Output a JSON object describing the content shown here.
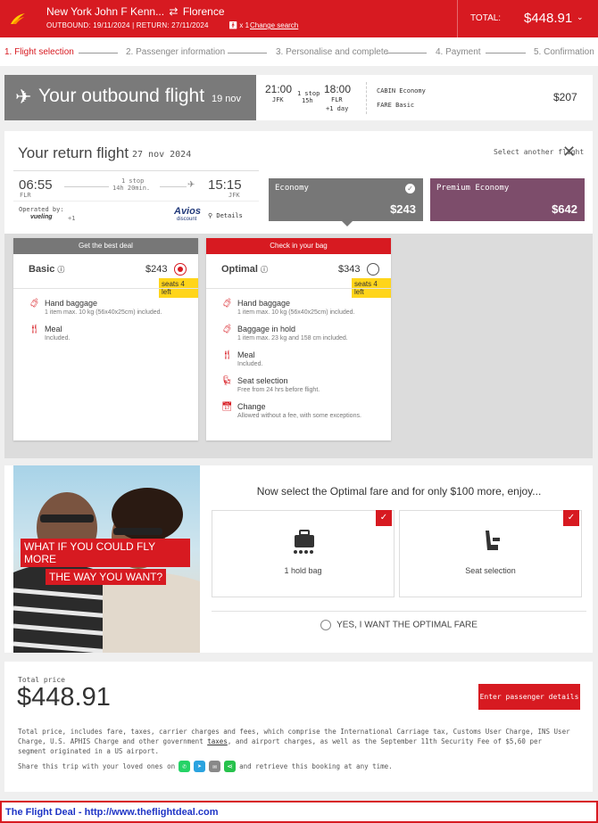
{
  "header": {
    "origin": "New York John F Kenn...",
    "swap_icon": "round-trip-arrows-icon",
    "destination": "Florence",
    "outbound_label": "OUTBOUND: 19/11/2024",
    "return_label": "RETURN: 27/11/2024",
    "passengers": "x 1",
    "change_search": "Change search",
    "total_label": "TOTAL:",
    "total_amount": "$448.91",
    "brand_color": "#d71a21"
  },
  "steps": [
    {
      "label": "1. Flight selection",
      "active": true
    },
    {
      "label": "2. Passenger information"
    },
    {
      "label": "3. Personalise and complete"
    },
    {
      "label": "4. Payment"
    },
    {
      "label": "5. Confirmation"
    }
  ],
  "outbound": {
    "title": "Your outbound flight",
    "date": "19 nov",
    "dep_time": "21:00",
    "dep_code": "JFK",
    "stops": "1 stop",
    "duration": "15h",
    "arr_time": "18:00",
    "arr_code": "FLR",
    "day_offset": "+1 day",
    "cabin_label": "CABIN",
    "cabin_value": "Economy",
    "fare_label": "FARE",
    "fare_value": "Basic",
    "price": "$207"
  },
  "return_flight": {
    "title": "Your return flight",
    "date": "27 nov 2024",
    "select_another": "Select another flight",
    "dep_time": "06:55",
    "dep_code": "FLR",
    "stops": "1 stop",
    "duration": "14h 20min.",
    "arr_time": "15:15",
    "arr_code": "JFK",
    "operated_by": "Operated by:",
    "operator": "vueling",
    "operator_extra": "+1",
    "avios": "Avios",
    "avios_sub": "discount",
    "details": "Details",
    "cabins": [
      {
        "name": "Economy",
        "price": "$243",
        "selected": true,
        "color": "#777777"
      },
      {
        "name": "Premium Economy",
        "price": "$642",
        "color": "#7d4d6b"
      }
    ]
  },
  "fares": [
    {
      "header": "Get the best deal",
      "name": "Basic",
      "price": "$243",
      "seats": "seats 4 left",
      "selected": true,
      "features": [
        {
          "icon": "hand-baggage-icon",
          "name": "Hand baggage",
          "desc": "1 item max. 10 kg (56x40x25cm) included."
        },
        {
          "icon": "meal-icon",
          "name": "Meal",
          "desc": "Included."
        }
      ]
    },
    {
      "header": "Check in your bag",
      "name": "Optimal",
      "price": "$343",
      "seats": "seats 4 left",
      "features": [
        {
          "icon": "hand-baggage-icon",
          "name": "Hand baggage",
          "desc": "1 item max. 10 kg (56x40x25cm) included."
        },
        {
          "icon": "hold-baggage-icon",
          "name": "Baggage in hold",
          "desc": "1 item max. 23 kg and 158 cm included."
        },
        {
          "icon": "meal-icon",
          "name": "Meal",
          "desc": "Included."
        },
        {
          "icon": "seat-icon",
          "name": "Seat selection",
          "desc": "Free from 24 hrs before flight."
        },
        {
          "icon": "calendar-change-icon",
          "name": "Change",
          "desc": "Allowed without a fee, with some exceptions."
        }
      ]
    }
  ],
  "promo": {
    "image_line1": "WHAT IF YOU COULD FLY MORE",
    "image_line2": "THE WAY YOU WANT?",
    "headline": "Now select the Optimal fare and for only $100 more, enjoy...",
    "option1": "1 hold bag",
    "option2": "Seat selection",
    "cta": "YES, I WANT THE OPTIMAL FARE"
  },
  "total": {
    "label": "Total price",
    "amount": "$448.91",
    "button": "Enter passenger details",
    "disclaimer_before": "Total price, includes fare, taxes, carrier charges and fees, which comprise the International Carriage tax, Customs User Charge, INS User Charge, U.S. APHIS Charge and other government ",
    "disclaimer_link": "taxes",
    "disclaimer_after": ", and airport charges, as well as the September 11th Security Fee of $5,60 per segment originated in a US airport.",
    "share_before": "Share this trip with your loved ones on",
    "share_after": "and retrieve this booking at any time."
  },
  "footer": {
    "text": "The Flight Deal - http://www.theflightdeal.com"
  }
}
